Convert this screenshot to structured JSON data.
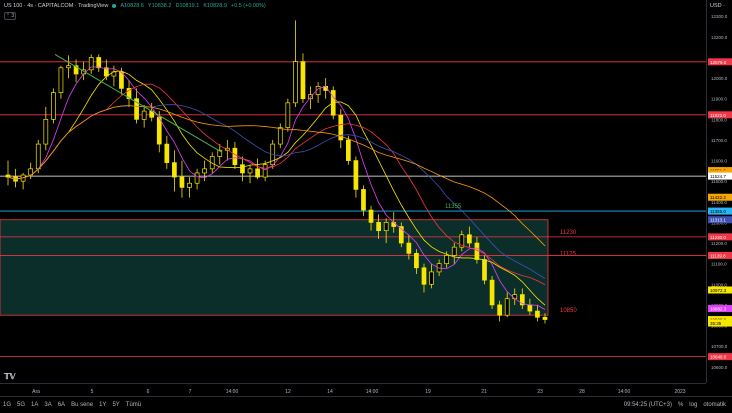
{
  "header": {
    "symbol": "US 100 · 4s · CAPITALCOM · TradingView",
    "open": "A10828.6",
    "high": "Y10838.2",
    "low": "D10819.1",
    "close": "K10828.9",
    "change": "+0.5 (+0.00%)",
    "collapse_label": "⌃ 3"
  },
  "price_axis": {
    "currency": "USD ·",
    "ticks": [
      "12300.0",
      "12200.0",
      "12000.0",
      "11900.0",
      "11800.0",
      "11700.0",
      "11600.0",
      "11500.0",
      "11400.0",
      "11300.0",
      "11200.0",
      "11100.0",
      "11000.0",
      "10900.0",
      "10800.0",
      "10700.0",
      "10600.0"
    ],
    "badges": [
      {
        "label": "12079.0",
        "price": 12079,
        "color": "#f23645",
        "text_color": "#ffffff"
      },
      {
        "label": "11822.0",
        "price": 11822,
        "color": "#f23645",
        "text_color": "#ffffff"
      },
      {
        "label": "11551.5",
        "price": 11551.5,
        "color": "#f7a600",
        "text_color": "#000000"
      },
      {
        "label": "11535.0",
        "price": 11535,
        "color": "#f7a600",
        "text_color": "#000000"
      },
      {
        "label": "11524.7",
        "price": 11524.7,
        "color": "#ffffff",
        "text_color": "#000000"
      },
      {
        "label": "11422.2",
        "price": 11422.2,
        "color": "#f7a600",
        "text_color": "#000000"
      },
      {
        "label": "11355.0",
        "price": 11355,
        "color": "#29b6f6",
        "text_color": "#000000"
      },
      {
        "label": "11313.1",
        "price": 11313.1,
        "color": "#3f51b5",
        "text_color": "#ffffff"
      },
      {
        "label": "11230.0",
        "price": 11230,
        "color": "#f23645",
        "text_color": "#ffffff"
      },
      {
        "label": "11139.8",
        "price": 11139.8,
        "color": "#f23645",
        "text_color": "#ffffff"
      },
      {
        "label": "10972.3",
        "price": 10972.3,
        "color": "#f7e600",
        "text_color": "#000000"
      },
      {
        "label": "10882.3",
        "price": 10882.3,
        "color": "#e040fb",
        "text_color": "#ffffff"
      },
      {
        "label": "10828.9",
        "price": 10828.9,
        "color": "#f7e600",
        "text_color": "#000000"
      },
      {
        "label": "35:35",
        "price": 10812,
        "color": "#f7e600",
        "text_color": "#000000"
      },
      {
        "label": "10649.0",
        "price": 10649,
        "color": "#f23645",
        "text_color": "#ffffff"
      }
    ]
  },
  "time_axis": {
    "labels": [
      "Ara",
      "5",
      "6",
      "7",
      "14:00",
      "12",
      "14",
      "14:00",
      "19",
      "21",
      "23",
      "28",
      "14:00",
      "2023",
      "4"
    ]
  },
  "bottom_bar": {
    "timeframes": [
      "1G",
      "5G",
      "1A",
      "3A",
      "6A",
      "Bu sene",
      "1Y",
      "5Y",
      "Tümü"
    ],
    "clock": "09:54:25 (UTC+3)",
    "percent": "%",
    "log": "log",
    "auto": "otomatik"
  },
  "chart_data": {
    "type": "candlestick",
    "title": "US 100 · 4s · CAPITALCOM",
    "ylim": [
      10560,
      12340
    ],
    "annotations": [
      {
        "text": "11355",
        "price": 11355,
        "color": "#4caf50"
      },
      {
        "text": "11230",
        "price": 11230,
        "color": "#f23645"
      },
      {
        "text": "11125",
        "price": 11125,
        "color": "#f23645"
      },
      {
        "text": "10850",
        "price": 10850,
        "color": "#f23645"
      }
    ],
    "horizontal_lines": [
      {
        "price": 12079,
        "color": "#f23645"
      },
      {
        "price": 11822,
        "color": "#f23645"
      },
      {
        "price": 11524.7,
        "color": "#ffffff"
      },
      {
        "price": 11355,
        "color": "#29b6f6"
      },
      {
        "price": 11230,
        "color": "#f23645"
      },
      {
        "price": 11139.8,
        "color": "#f23645"
      },
      {
        "price": 10649,
        "color": "#f23645"
      }
    ],
    "zone": {
      "top": 11313,
      "bottom": 10850,
      "color": "#26a69a"
    },
    "trendline": {
      "from": [
        12115,
        1
      ],
      "to": [
        11640,
        1
      ],
      "color": "#4caf50"
    },
    "candles": [
      [
        11530,
        11600,
        11480,
        11520
      ],
      [
        11520,
        11560,
        11470,
        11500
      ],
      [
        11500,
        11540,
        11460,
        11530
      ],
      [
        11530,
        11590,
        11510,
        11560
      ],
      [
        11560,
        11700,
        11540,
        11680
      ],
      [
        11680,
        11860,
        11650,
        11800
      ],
      [
        11800,
        11950,
        11780,
        11930
      ],
      [
        11930,
        12060,
        11900,
        12050
      ],
      [
        12050,
        12110,
        12000,
        12060
      ],
      [
        12060,
        12090,
        11980,
        12020
      ],
      [
        12020,
        12080,
        11990,
        12040
      ],
      [
        12040,
        12115,
        12020,
        12100
      ],
      [
        12100,
        12115,
        12030,
        12050
      ],
      [
        12050,
        12090,
        11990,
        12010
      ],
      [
        12010,
        12060,
        11960,
        12030
      ],
      [
        12030,
        12050,
        11920,
        11950
      ],
      [
        11950,
        11990,
        11860,
        11900
      ],
      [
        11900,
        11950,
        11780,
        11800
      ],
      [
        11800,
        11870,
        11760,
        11840
      ],
      [
        11840,
        11880,
        11790,
        11810
      ],
      [
        11810,
        11840,
        11640,
        11680
      ],
      [
        11680,
        11720,
        11560,
        11590
      ],
      [
        11590,
        11650,
        11450,
        11520
      ],
      [
        11520,
        11600,
        11420,
        11470
      ],
      [
        11470,
        11520,
        11420,
        11490
      ],
      [
        11490,
        11560,
        11460,
        11540
      ],
      [
        11540,
        11600,
        11500,
        11560
      ],
      [
        11560,
        11640,
        11540,
        11620
      ],
      [
        11620,
        11680,
        11580,
        11650
      ],
      [
        11650,
        11700,
        11600,
        11660
      ],
      [
        11660,
        11690,
        11560,
        11580
      ],
      [
        11580,
        11620,
        11500,
        11540
      ],
      [
        11540,
        11580,
        11490,
        11560
      ],
      [
        11560,
        11610,
        11510,
        11520
      ],
      [
        11520,
        11600,
        11500,
        11580
      ],
      [
        11580,
        11700,
        11560,
        11680
      ],
      [
        11680,
        11780,
        11660,
        11760
      ],
      [
        11760,
        11900,
        11740,
        11880
      ],
      [
        11880,
        12280,
        11860,
        12080
      ],
      [
        12080,
        12120,
        11880,
        11900
      ],
      [
        11900,
        11960,
        11850,
        11920
      ],
      [
        11920,
        11980,
        11880,
        11960
      ],
      [
        11960,
        12000,
        11900,
        11940
      ],
      [
        11940,
        11960,
        11800,
        11820
      ],
      [
        11820,
        11850,
        11660,
        11700
      ],
      [
        11700,
        11720,
        11580,
        11600
      ],
      [
        11600,
        11620,
        11420,
        11460
      ],
      [
        11460,
        11480,
        11330,
        11360
      ],
      [
        11360,
        11380,
        11260,
        11300
      ],
      [
        11300,
        11340,
        11220,
        11260
      ],
      [
        11260,
        11320,
        11200,
        11300
      ],
      [
        11300,
        11350,
        11250,
        11280
      ],
      [
        11280,
        11300,
        11180,
        11200
      ],
      [
        11200,
        11240,
        11120,
        11150
      ],
      [
        11150,
        11170,
        11050,
        11080
      ],
      [
        11080,
        11100,
        10960,
        11000
      ],
      [
        11000,
        11100,
        10980,
        11060
      ],
      [
        11060,
        11120,
        11040,
        11100
      ],
      [
        11100,
        11160,
        11080,
        11140
      ],
      [
        11140,
        11200,
        11100,
        11180
      ],
      [
        11180,
        11260,
        11160,
        11240
      ],
      [
        11240,
        11280,
        11180,
        11200
      ],
      [
        11200,
        11230,
        11100,
        11120
      ],
      [
        11120,
        11140,
        11000,
        11020
      ],
      [
        11020,
        11040,
        10880,
        10900
      ],
      [
        10900,
        10920,
        10820,
        10850
      ],
      [
        10850,
        10960,
        10840,
        10930
      ],
      [
        10930,
        10980,
        10900,
        10950
      ],
      [
        10950,
        10980,
        10880,
        10900
      ],
      [
        10900,
        10930,
        10850,
        10870
      ],
      [
        10870,
        10900,
        10820,
        10840
      ],
      [
        10840,
        10860,
        10810,
        10828.9
      ]
    ]
  }
}
